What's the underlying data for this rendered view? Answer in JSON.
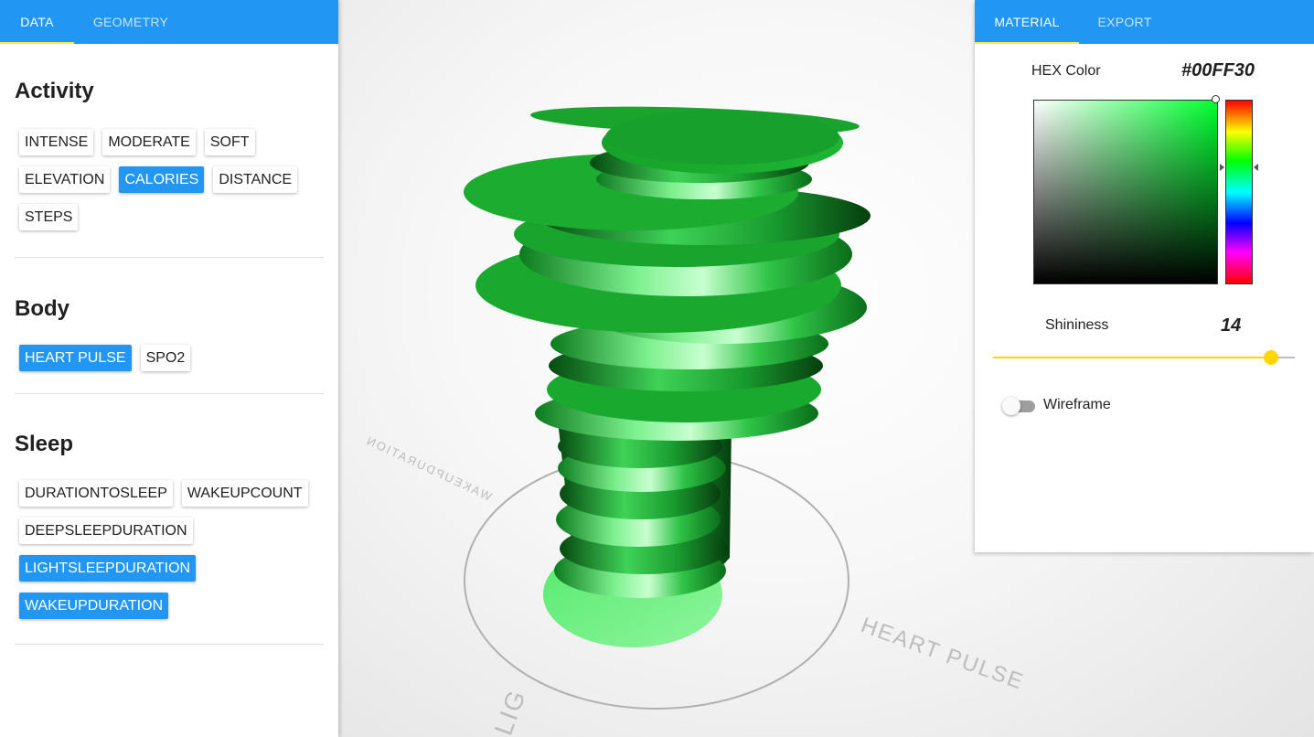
{
  "left_tabs": [
    "DATA",
    "GEOMETRY"
  ],
  "right_tabs": [
    "MATERIAL",
    "EXPORT"
  ],
  "sections": {
    "activity": {
      "title": "Activity",
      "chips": [
        {
          "label": "INTENSE",
          "active": false
        },
        {
          "label": "MODERATE",
          "active": false
        },
        {
          "label": "SOFT",
          "active": false
        },
        {
          "label": "ELEVATION",
          "active": false
        },
        {
          "label": "CALORIES",
          "active": true
        },
        {
          "label": "DISTANCE",
          "active": false
        },
        {
          "label": "STEPS",
          "active": false
        }
      ]
    },
    "body": {
      "title": "Body",
      "chips": [
        {
          "label": "HEART PULSE",
          "active": true
        },
        {
          "label": "SPO2",
          "active": false
        }
      ]
    },
    "sleep": {
      "title": "Sleep",
      "chips": [
        {
          "label": "DURATIONTOSLEEP",
          "active": false
        },
        {
          "label": "WAKEUPCOUNT",
          "active": false
        },
        {
          "label": "DEEPSLEEPDURATION",
          "active": false
        },
        {
          "label": "LIGHTSLEEPDURATION",
          "active": true
        },
        {
          "label": "WAKEUPDURATION",
          "active": true
        }
      ]
    }
  },
  "material": {
    "hex_label": "HEX Color",
    "hex_value": "#00FF30",
    "shininess_label": "Shininess",
    "shininess_value": "14",
    "shininess_fraction": 0.92,
    "wireframe_label": "Wireframe",
    "wireframe_on": false
  },
  "viewport": {
    "axis_labels": [
      "WAKEUPDURATION",
      "HEART PULSE",
      "LIG"
    ],
    "model_color": "#00ff30"
  },
  "colors": {
    "accent": "#2196f3",
    "tab_indicator": "#ffeb3b",
    "slider": "#ffd600"
  }
}
